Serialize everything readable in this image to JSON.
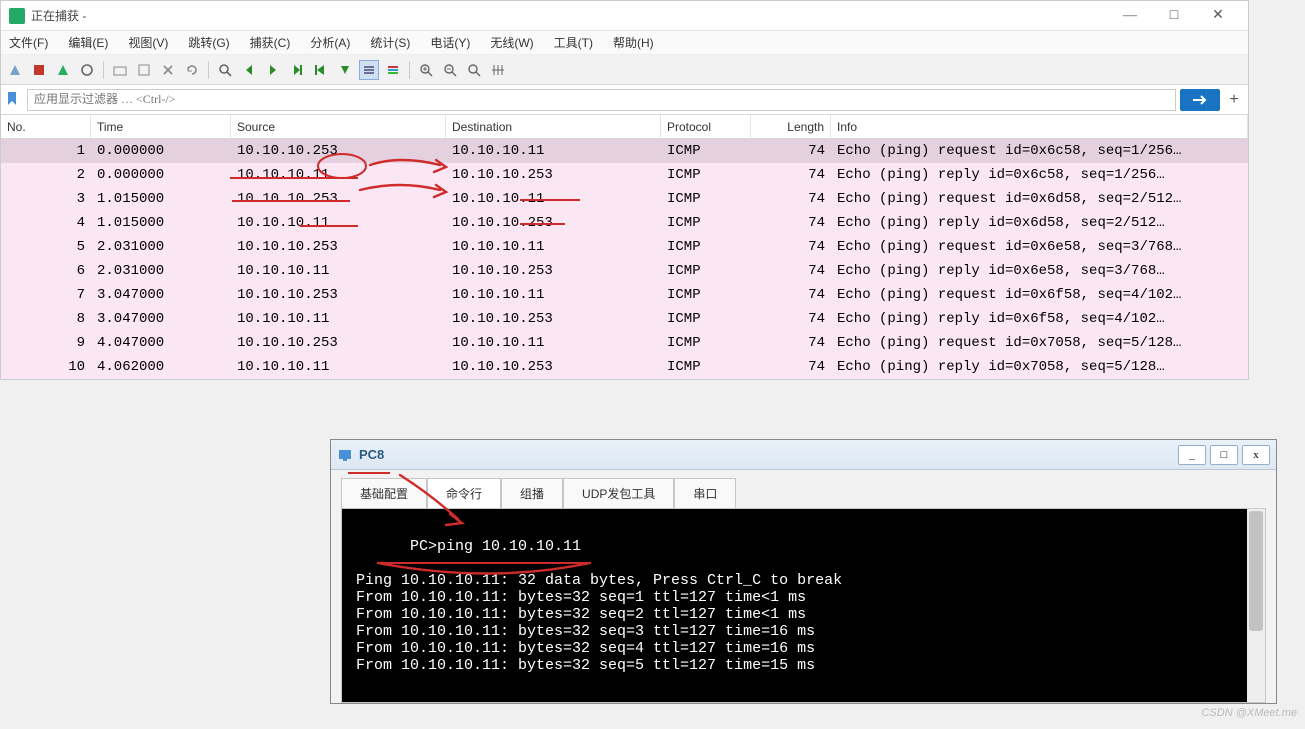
{
  "wireshark": {
    "title": "正在捕获 -",
    "win_controls": {
      "minimize": "—",
      "maximize": "□",
      "close": "✕"
    },
    "menu": [
      "文件(F)",
      "编辑(E)",
      "视图(V)",
      "跳转(G)",
      "捕获(C)",
      "分析(A)",
      "统计(S)",
      "电话(Y)",
      "无线(W)",
      "工具(T)",
      "帮助(H)"
    ],
    "filter_placeholder": "应用显示过滤器 … <Ctrl-/>",
    "plus": "+",
    "columns": {
      "no": "No.",
      "time": "Time",
      "source": "Source",
      "destination": "Destination",
      "protocol": "Protocol",
      "length": "Length",
      "info": "Info"
    },
    "rows": [
      {
        "no": "1",
        "time": "0.000000",
        "src": "10.10.10.253",
        "dst": "10.10.10.11",
        "proto": "ICMP",
        "len": "74",
        "info": "Echo (ping) request  id=0x6c58, seq=1/256…",
        "sel": true
      },
      {
        "no": "2",
        "time": "0.000000",
        "src": "10.10.10.11",
        "dst": "10.10.10.253",
        "proto": "ICMP",
        "len": "74",
        "info": "Echo (ping) reply    id=0x6c58, seq=1/256…"
      },
      {
        "no": "3",
        "time": "1.015000",
        "src": "10.10.10.253",
        "dst": "10.10.10.11",
        "proto": "ICMP",
        "len": "74",
        "info": "Echo (ping) request  id=0x6d58, seq=2/512…"
      },
      {
        "no": "4",
        "time": "1.015000",
        "src": "10.10.10.11",
        "dst": "10.10.10.253",
        "proto": "ICMP",
        "len": "74",
        "info": "Echo (ping) reply    id=0x6d58, seq=2/512…"
      },
      {
        "no": "5",
        "time": "2.031000",
        "src": "10.10.10.253",
        "dst": "10.10.10.11",
        "proto": "ICMP",
        "len": "74",
        "info": "Echo (ping) request  id=0x6e58, seq=3/768…"
      },
      {
        "no": "6",
        "time": "2.031000",
        "src": "10.10.10.11",
        "dst": "10.10.10.253",
        "proto": "ICMP",
        "len": "74",
        "info": "Echo (ping) reply    id=0x6e58, seq=3/768…"
      },
      {
        "no": "7",
        "time": "3.047000",
        "src": "10.10.10.253",
        "dst": "10.10.10.11",
        "proto": "ICMP",
        "len": "74",
        "info": "Echo (ping) request  id=0x6f58, seq=4/102…"
      },
      {
        "no": "8",
        "time": "3.047000",
        "src": "10.10.10.11",
        "dst": "10.10.10.253",
        "proto": "ICMP",
        "len": "74",
        "info": "Echo (ping) reply    id=0x6f58, seq=4/102…"
      },
      {
        "no": "9",
        "time": "4.047000",
        "src": "10.10.10.253",
        "dst": "10.10.10.11",
        "proto": "ICMP",
        "len": "74",
        "info": "Echo (ping) request  id=0x7058, seq=5/128…"
      },
      {
        "no": "10",
        "time": "4.062000",
        "src": "10.10.10.11",
        "dst": "10.10.10.253",
        "proto": "ICMP",
        "len": "74",
        "info": "Echo (ping) reply    id=0x7058, seq=5/128…"
      }
    ]
  },
  "pc8": {
    "title": "PC8",
    "win_controls": {
      "minimize": "_",
      "maximize": "□",
      "close": "x"
    },
    "tabs": [
      "基础配置",
      "命令行",
      "组播",
      "UDP发包工具",
      "串口"
    ],
    "active_tab": 1,
    "console": "PC>ping 10.10.10.11\n\nPing 10.10.10.11: 32 data bytes, Press Ctrl_C to break\nFrom 10.10.10.11: bytes=32 seq=1 ttl=127 time<1 ms\nFrom 10.10.10.11: bytes=32 seq=2 ttl=127 time<1 ms\nFrom 10.10.10.11: bytes=32 seq=3 ttl=127 time=16 ms\nFrom 10.10.10.11: bytes=32 seq=4 ttl=127 time=16 ms\nFrom 10.10.10.11: bytes=32 seq=5 ttl=127 time=15 ms"
  },
  "watermark": "CSDN @XMeet.me"
}
